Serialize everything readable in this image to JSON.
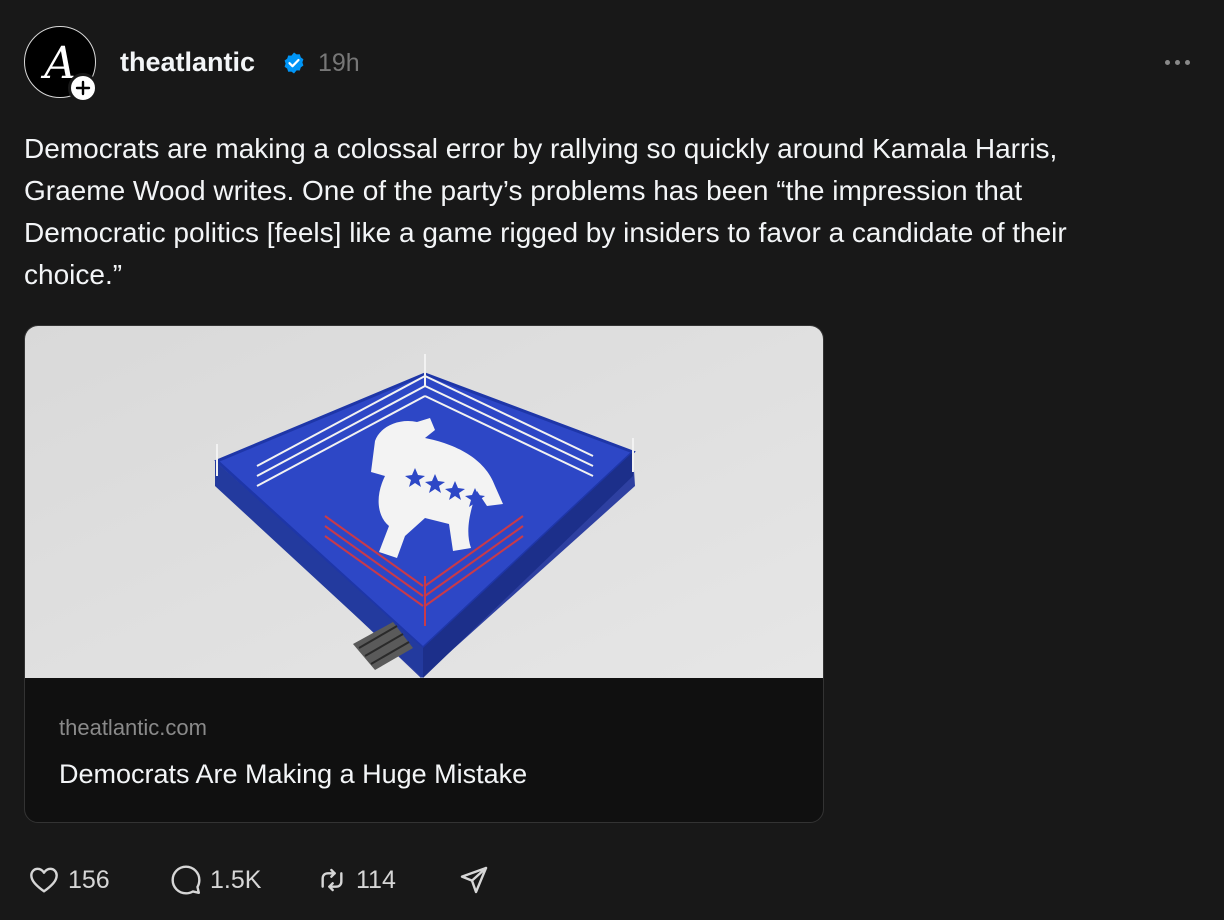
{
  "post": {
    "avatar_letter": "A",
    "username": "theatlantic",
    "timestamp": "19h",
    "caption": "Democrats are making a colossal error by rallying so quickly around Kamala Harris,\nGraeme Wood writes. One of the party’s problems has been “the impression that\nDemocratic politics [feels] like a game rigged by insiders to favor a candidate of their\nchoice.”"
  },
  "link_card": {
    "domain": "theatlantic.com",
    "title": "Democrats Are Making a Huge Mistake"
  },
  "actions": {
    "likes": "156",
    "replies": "1.5K",
    "reposts": "114"
  },
  "icons": [
    "verified-icon",
    "plus-icon",
    "more-icon",
    "heart-icon",
    "comment-icon",
    "repost-icon",
    "share-icon"
  ],
  "colors": {
    "background": "#181818",
    "verified": "#0095f6",
    "ring": "#2646b8"
  }
}
